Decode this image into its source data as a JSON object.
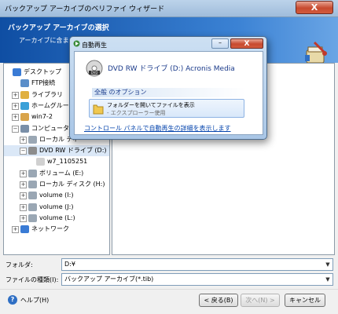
{
  "window": {
    "title": "バックアップ アーカイブのベリファイ ウィザード",
    "close_label": "X"
  },
  "header": {
    "step_title": "バックアップ アーカイブの選択",
    "description": "アーカイブに含ま                                                              カイブを選択し [次へ] を"
  },
  "tree": {
    "items": [
      {
        "label": "デスクトップ",
        "icon": "desktop-icon",
        "level": 0,
        "expander": ""
      },
      {
        "label": "FTP接続",
        "icon": "ftp-icon",
        "level": 1,
        "expander": ""
      },
      {
        "label": "ライブラリ",
        "icon": "library-icon",
        "level": 1,
        "expander": "+"
      },
      {
        "label": "ホームグループ",
        "icon": "homegroup-icon",
        "level": 1,
        "expander": "+"
      },
      {
        "label": "win7-2",
        "icon": "user-icon",
        "level": 1,
        "expander": "+"
      },
      {
        "label": "コンピューター",
        "icon": "computer-icon",
        "level": 1,
        "expander": "−"
      },
      {
        "label": "ローカル ディ",
        "icon": "drive-icon",
        "level": 2,
        "expander": "+"
      },
      {
        "label": "DVD RW ドライブ (D:)",
        "icon": "dvd-icon",
        "level": 2,
        "expander": "−",
        "selected": true
      },
      {
        "label": "w7_1105251",
        "icon": "file-icon",
        "level": 3,
        "expander": ""
      },
      {
        "label": "ボリューム (E:)",
        "icon": "drive-icon",
        "level": 2,
        "expander": "+"
      },
      {
        "label": "ローカル ディスク (H:)",
        "icon": "drive-icon",
        "level": 2,
        "expander": "+"
      },
      {
        "label": "volume (I:)",
        "icon": "drive-icon",
        "level": 2,
        "expander": "+"
      },
      {
        "label": "volume (J:)",
        "icon": "drive-icon",
        "level": 2,
        "expander": "+"
      },
      {
        "label": "volume (L:)",
        "icon": "drive-icon",
        "level": 2,
        "expander": "+"
      },
      {
        "label": "ネットワーク",
        "icon": "network-icon",
        "level": 1,
        "expander": "+"
      }
    ]
  },
  "fields": {
    "folder_label": "フォルダ:",
    "folder_value": "D:¥",
    "filetype_label": "ファイルの種類(I):",
    "filetype_value": "バックアップ アーカイブ(*.tib)"
  },
  "buttons": {
    "help": "ヘルプ(H)",
    "back": "< 戻る(B)",
    "next": "次へ(N) >",
    "cancel": "キャンセル"
  },
  "autoplay": {
    "title": "自動再生",
    "minimize": "–",
    "close": "X",
    "device": "DVD RW ドライブ (D:) Acronis Media",
    "group_label": "全般 のオプション",
    "option_title": "フォルダーを開いてファイルを表示",
    "option_sub": "- エクスプローラー使用",
    "settings_link": "コントロール パネルで自動再生の詳細を表示します"
  },
  "colors": {
    "header_blue": "#1f5fb8",
    "link": "#0645ad",
    "selection": "#dbe8f7"
  }
}
